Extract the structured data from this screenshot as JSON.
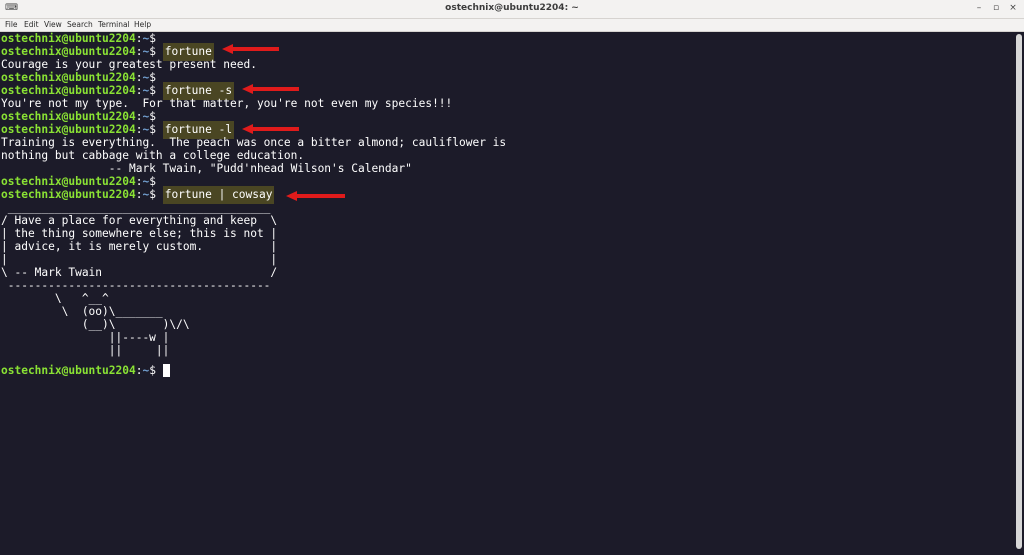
{
  "window": {
    "title": "ostechnix@ubuntu2204: ~",
    "app_icon": "⌨",
    "minimize_glyph": "–",
    "maximize_glyph": "▫",
    "close_glyph": "×"
  },
  "menu": [
    "File",
    "Edit",
    "View",
    "Search",
    "Terminal",
    "Help"
  ],
  "prompt": {
    "user": "ostechnix@ubuntu2204",
    "colon": ":",
    "path": "~",
    "dollar": "$ "
  },
  "commands": {
    "c1": "fortune",
    "c2": "fortune -s",
    "c3": "fortune -l",
    "c4": "fortune | cowsay"
  },
  "output": {
    "o1": "Courage is your greatest present need.",
    "o2": "You're not my type.  For that matter, you're not even my species!!!",
    "o3a": "Training is everything.  The peach was once a bitter almond; cauliflower is",
    "o3b": "nothing but cabbage with a college education.",
    "o3c": "                -- Mark Twain, \"Pudd'nhead Wilson's Calendar\"",
    "cow": [
      " _______________________________________",
      "/ Have a place for everything and keep  \\",
      "| the thing somewhere else; this is not |",
      "| advice, it is merely custom.          |",
      "|                                       |",
      "\\ -- Mark Twain                         /",
      " ---------------------------------------",
      "        \\   ^__^",
      "         \\  (oo)\\_______",
      "            (__)\\       )\\/\\",
      "                ||----w |",
      "                ||     ||"
    ]
  },
  "colors": {
    "background": "#1c1b29",
    "prompt_user": "#8ae234",
    "prompt_path": "#729fcf",
    "command_highlight": "#4a4623",
    "arrow": "#e01b1b"
  }
}
